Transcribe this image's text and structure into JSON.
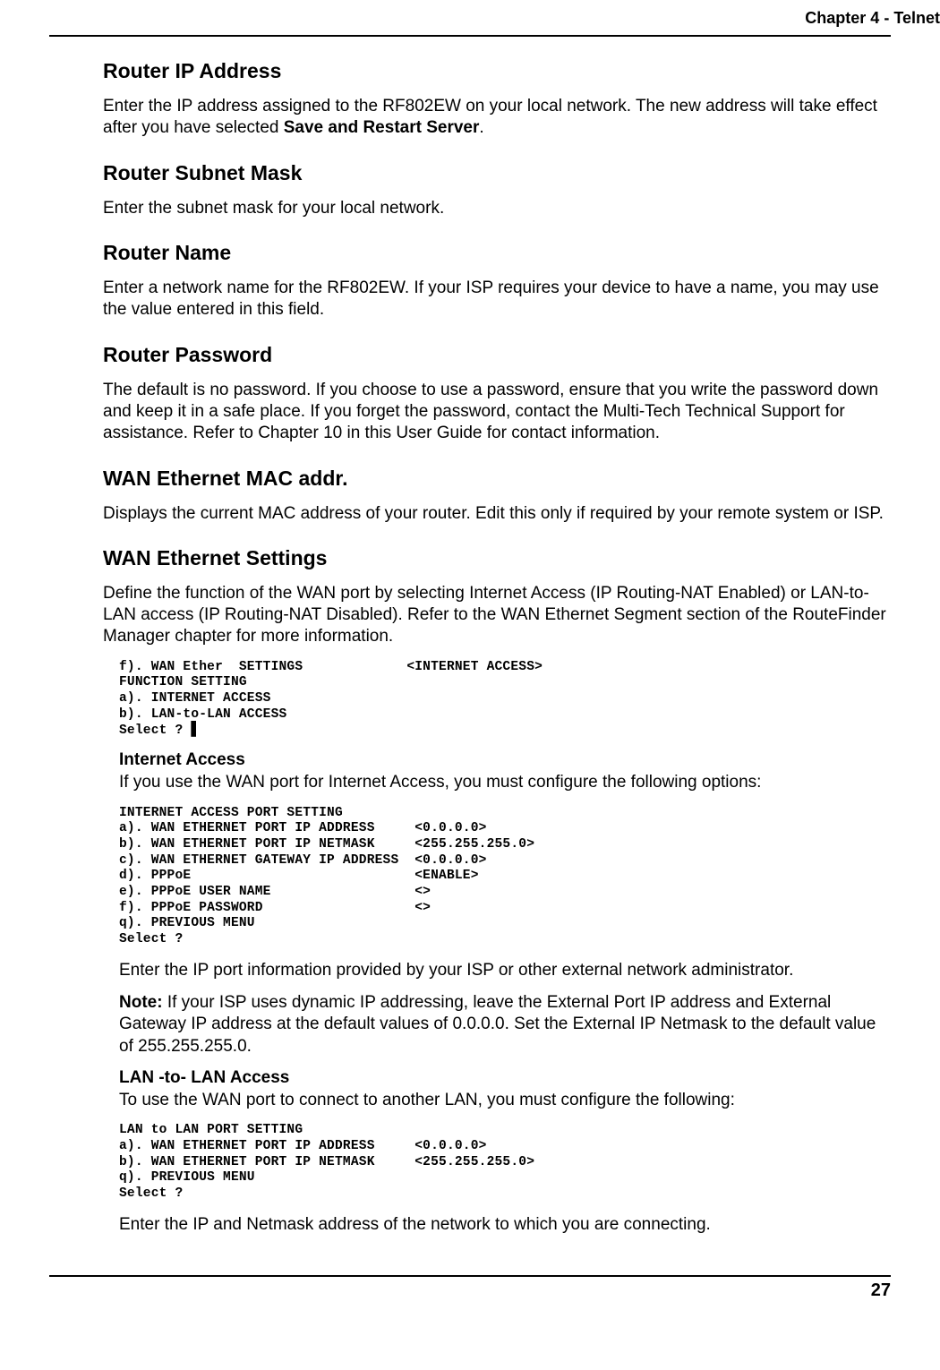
{
  "header": "Chapter 4 -  Telnet",
  "s1": {
    "h": "Router IP Address",
    "p1a": "Enter the IP address assigned to the RF802EW on your local network.  The new address will take effect after you have selected ",
    "p1b": "Save and Restart Server",
    "p1c": "."
  },
  "s2": {
    "h": "Router Subnet Mask",
    "p": "Enter the subnet mask for your local network."
  },
  "s3": {
    "h": "Router Name",
    "p": "Enter a network name for the RF802EW.  If your ISP requires your device to have a name, you may use the value entered in this field."
  },
  "s4": {
    "h": "Router Password",
    "p": "The default is no password.  If you choose to use a password, ensure that you write the password down and keep it in a safe place.  If you forget the password, contact the Multi-Tech Technical Support for assistance.  Refer to Chapter 10 in this User Guide for contact information."
  },
  "s5": {
    "h": "WAN Ethernet MAC addr.",
    "p": "Displays the current MAC address of your router. Edit this only if required by your remote system or ISP."
  },
  "s6": {
    "h": "WAN Ethernet Settings",
    "p": "Define the function of the WAN port by selecting Internet Access (IP Routing-NAT Enabled) or LAN-to-LAN access (IP Routing-NAT Disabled).  Refer to the WAN Ethernet Segment section of the RouteFinder Manager chapter for more information."
  },
  "code1": "f). WAN Ether  SETTINGS             <INTERNET ACCESS>\nFUNCTION SETTING\na). INTERNET ACCESS\nb). LAN-to-LAN ACCESS\nSelect ? ▋",
  "ia": {
    "h": "Internet Access",
    "p": "If you use the WAN port for Internet Access, you must configure the following options:"
  },
  "code2": "INTERNET ACCESS PORT SETTING\na). WAN ETHERNET PORT IP ADDRESS     <0.0.0.0>\nb). WAN ETHERNET PORT IP NETMASK     <255.255.255.0>\nc). WAN ETHERNET GATEWAY IP ADDRESS  <0.0.0.0>\nd). PPPoE                            <ENABLE>\ne). PPPoE USER NAME                  <>\nf). PPPoE PASSWORD                   <>\nq). PREVIOUS MENU\nSelect ?",
  "ia2": "Enter the IP port information provided by your ISP or other external network administrator.",
  "note": {
    "label": "Note:",
    "text": " If your ISP uses dynamic IP addressing, leave the External Port IP address and External Gateway IP address at the default values of 0.0.0.0.  Set the External IP Netmask to the default value of 255.255.255.0."
  },
  "ll": {
    "h": "LAN -to- LAN Access",
    "p": "To use the WAN port to connect to another LAN, you must configure the following:"
  },
  "code3": "LAN to LAN PORT SETTING\na). WAN ETHERNET PORT IP ADDRESS     <0.0.0.0>\nb). WAN ETHERNET PORT IP NETMASK     <255.255.255.0>\nq). PREVIOUS MENU\nSelect ?",
  "ll2": "Enter the IP and Netmask address of the network to which you are connecting.",
  "pagenum": "27"
}
